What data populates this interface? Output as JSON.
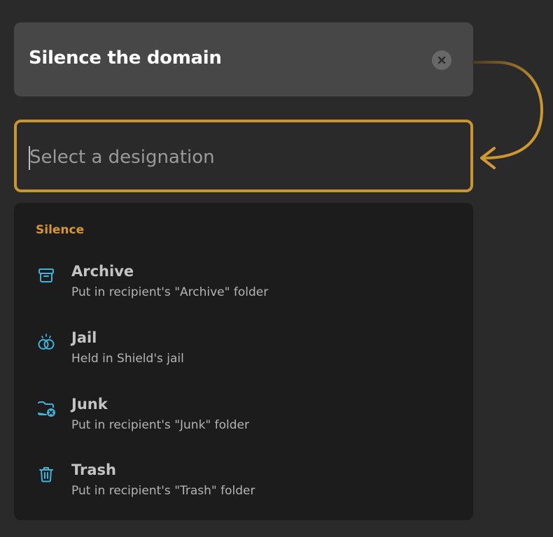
{
  "action": {
    "title": "Silence the domain",
    "clear_icon": "close-icon"
  },
  "designation_select": {
    "placeholder": "Select a designation",
    "value": ""
  },
  "dropdown": {
    "group_label": "Silence",
    "options": [
      {
        "icon": "archive-icon",
        "title": "Archive",
        "description": "Put in recipient's \"Archive\" folder"
      },
      {
        "icon": "jail-icon",
        "title": "Jail",
        "description": "Held in Shield's jail"
      },
      {
        "icon": "folder-x-icon",
        "title": "Junk",
        "description": "Put in recipient's \"Junk\" folder"
      },
      {
        "icon": "trash-icon",
        "title": "Trash",
        "description": "Put in recipient's \"Trash\" folder"
      }
    ]
  },
  "colors": {
    "accent": "#c9952e",
    "group_label": "#d4962f",
    "icon": "#3fb3d8",
    "card_bg": "#474747",
    "dropdown_bg": "#1c1c1c",
    "page_bg": "#2a2a2a"
  }
}
